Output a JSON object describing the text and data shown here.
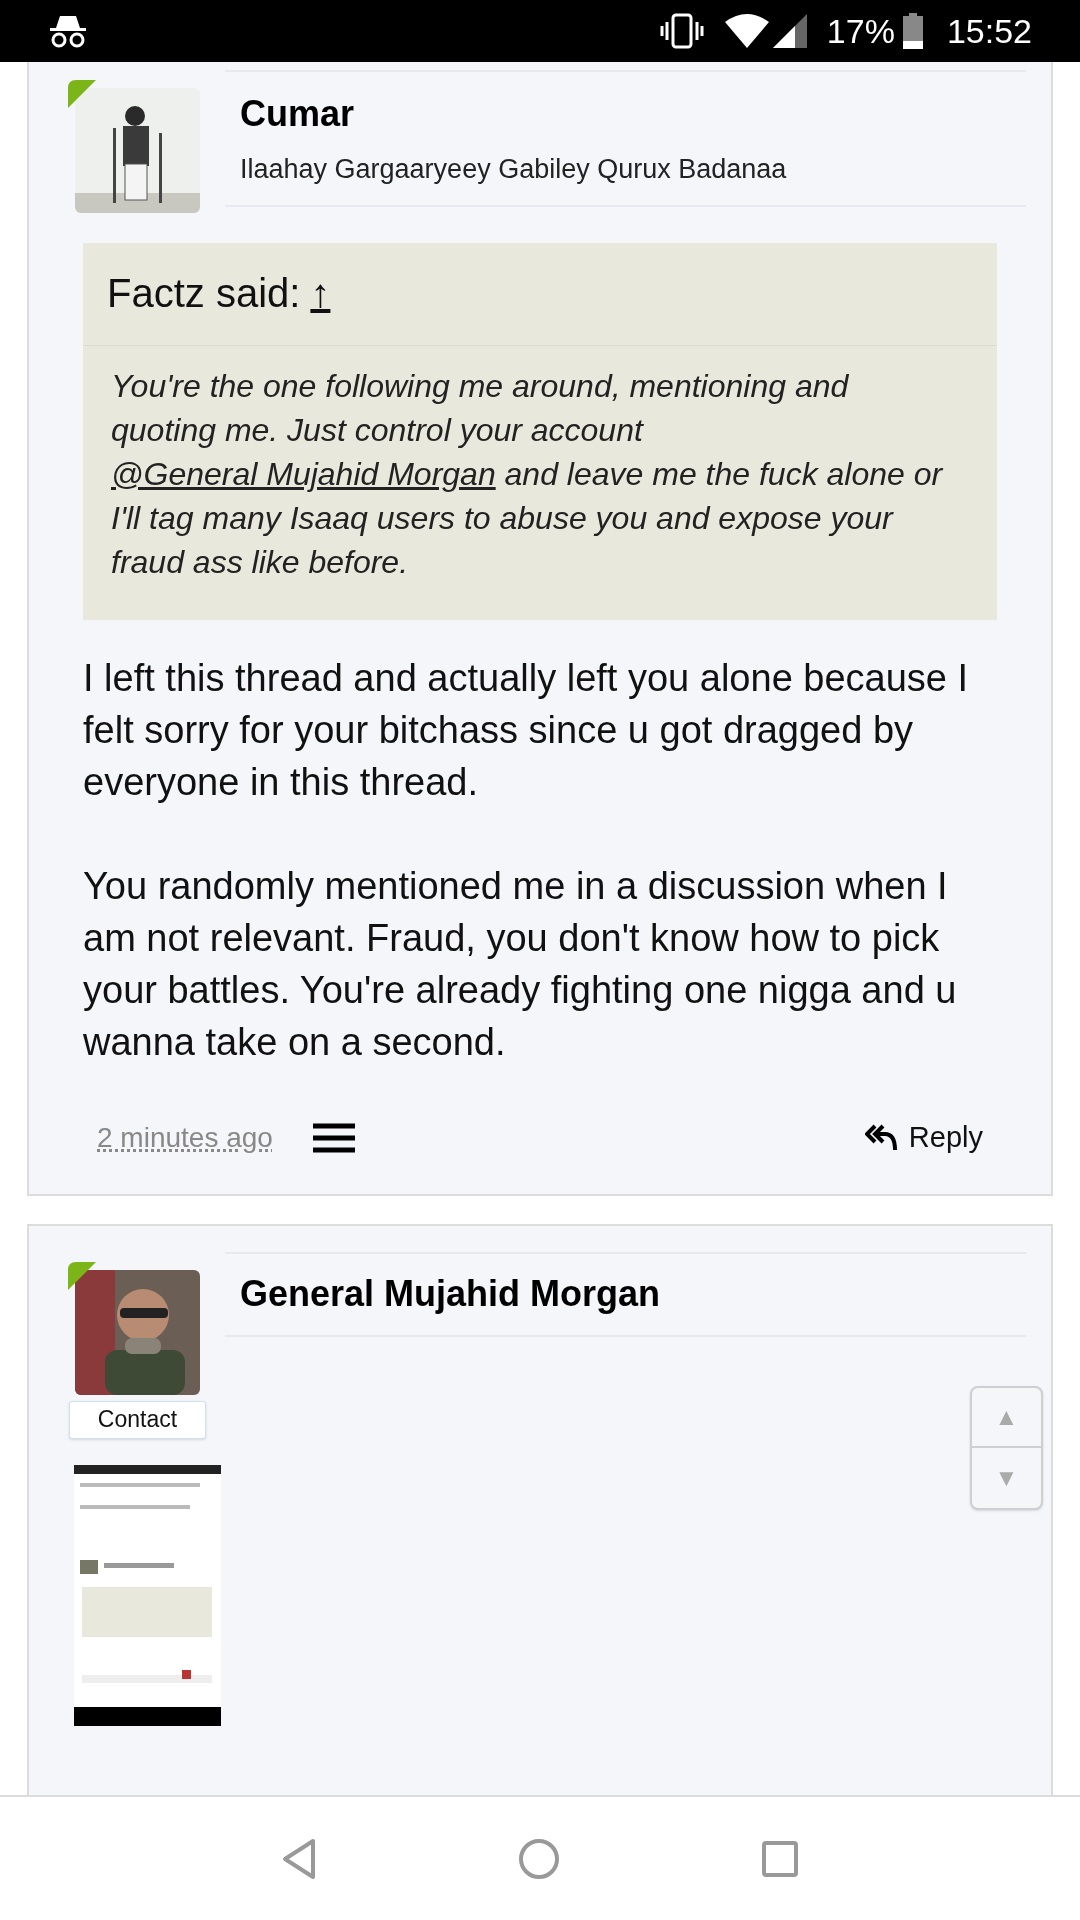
{
  "status_bar": {
    "battery": "17%",
    "time": "15:52"
  },
  "posts": [
    {
      "author": "Cumar",
      "subtitle": "Ilaahay Gargaaryeey Gabiley Qurux Badanaa",
      "online": true,
      "quote": {
        "header": "Factz said:",
        "jump": "↑",
        "body": "You're the one following me around, mentioning and quoting me. Just control your account ",
        "mention": "@General Mujahid Morgan",
        "body_end": " and leave me the fuck alone or I'll tag many Isaaq users to abuse you and expose your fraud ass like before."
      },
      "paragraphs": [
        "I left this thread and actually left you alone because I felt sorry for your bitchass since u got dragged by everyone in this thread.",
        "You randomly mentioned me in a discussion when I am not relevant. Fraud, you don't know how to pick your battles. You're already fighting one nigga and u wanna take on a second."
      ],
      "time": "2 minutes ago",
      "reply": "Reply"
    },
    {
      "author": "General Mujahid Morgan",
      "online": true,
      "contact": "Contact",
      "scroll_up": "▲",
      "scroll_down": "▼"
    }
  ]
}
